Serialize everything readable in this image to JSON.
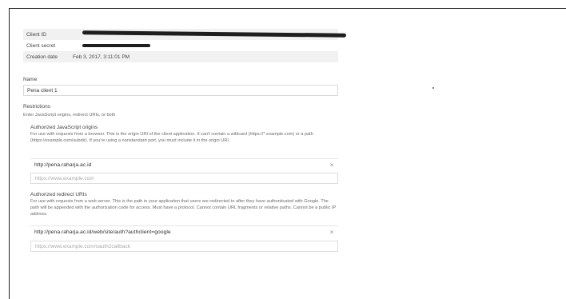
{
  "credentials": {
    "client_id_label": "Client ID",
    "client_secret_label": "Client secret",
    "creation_date_label": "Creation date",
    "creation_date_value": "Feb 3, 2017, 3:11:01 PM"
  },
  "name": {
    "label": "Name",
    "value": "Pena client 1"
  },
  "restrictions": {
    "label": "Restrictions",
    "help": "Enter JavaScript origins, redirect URIs, or both"
  },
  "js_origins": {
    "heading": "Authorized JavaScript origins",
    "help": "For use with requests from a browser. This is the origin URI of the client application. It can't contain a wildcard (https://*.example.com) or a path (https://example.com/subdir). If you're using a nonstandard port, you must include it in the origin URI.",
    "entry": "http://pena.raharja.ac.id",
    "placeholder": "https://www.example.com"
  },
  "redirect_uris": {
    "heading": "Authorized redirect URIs",
    "help": "For use with requests from a web server. This is the path in your application that users are redirected to after they have authenticated with Google. The path will be appended with the authorization code for access. Must have a protocol. Cannot contain URL fragments or relative paths. Cannot be a public IP address.",
    "entry": "http://pena.raharja.ac.id/web/site/auth?authclient=google",
    "placeholder": "https://www.example.com/oauth2callback"
  },
  "icons": {
    "remove": "×"
  }
}
